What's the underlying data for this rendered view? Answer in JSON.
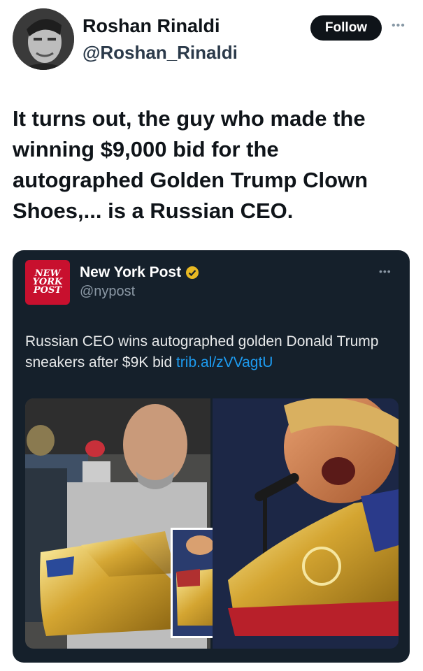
{
  "author": {
    "name": "Roshan Rinaldi",
    "handle": "@Roshan_Rinaldi",
    "avatar_icon": "profile-photo"
  },
  "follow_label": "Follow",
  "more_icon": "ellipsis-icon",
  "tweet": {
    "text": "It turns out, the guy who made the winning $9,000 bid for the autographed Golden Trump Clown Shoes,... is a Russian CEO."
  },
  "quote": {
    "logo_lines": [
      "NEW",
      "YORK",
      "POST"
    ],
    "name": "New York Post",
    "handle": "@nypost",
    "text": "Russian CEO wins autographed golden Donald Trump sneakers after $9K bid ",
    "link": "trib.al/zVVagtU",
    "verified_color": "#e8b923",
    "media_theme": "golden-sneakers-photo"
  },
  "colors": {
    "card_bg": "#15202b",
    "link": "#1d9bf0",
    "logo_red": "#c8102e"
  }
}
